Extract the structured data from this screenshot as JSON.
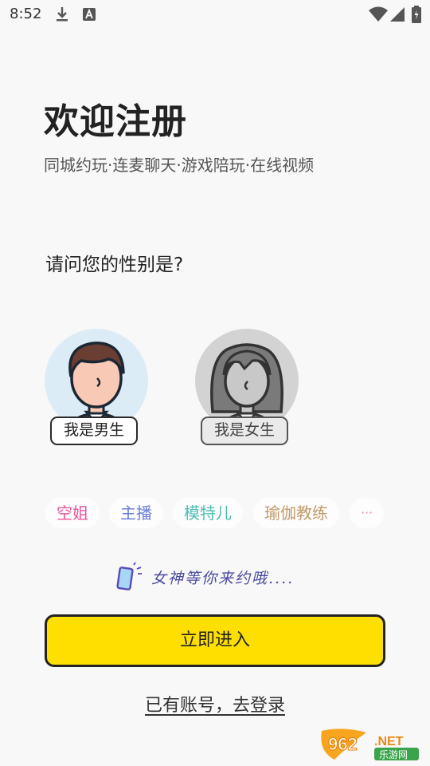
{
  "status_bar": {
    "time": "8:52"
  },
  "header": {
    "title": "欢迎注册",
    "subtitle": "同城约玩·连麦聊天·游戏陪玩·在线视频"
  },
  "gender": {
    "question": "请问您的性别是?",
    "male_label": "我是男生",
    "female_label": "我是女生"
  },
  "tags": [
    {
      "label": "空姐",
      "color": "#e8559a"
    },
    {
      "label": "主播",
      "color": "#6b7fd6"
    },
    {
      "label": "模特儿",
      "color": "#4fbfb0"
    },
    {
      "label": "瑜伽教练",
      "color": "#c29a6a"
    },
    {
      "label": "···",
      "color": "#e88aa8"
    }
  ],
  "slogan": "女神等你来约哦....",
  "enter_button": "立即进入",
  "login_link": "已有账号，去登录",
  "watermark": {
    "brand": "962.NET",
    "sub": "乐游网"
  },
  "colors": {
    "accent_yellow": "#ffdf00",
    "male_bg": "#dcecf7",
    "female_bg": "#d3d3d3"
  }
}
